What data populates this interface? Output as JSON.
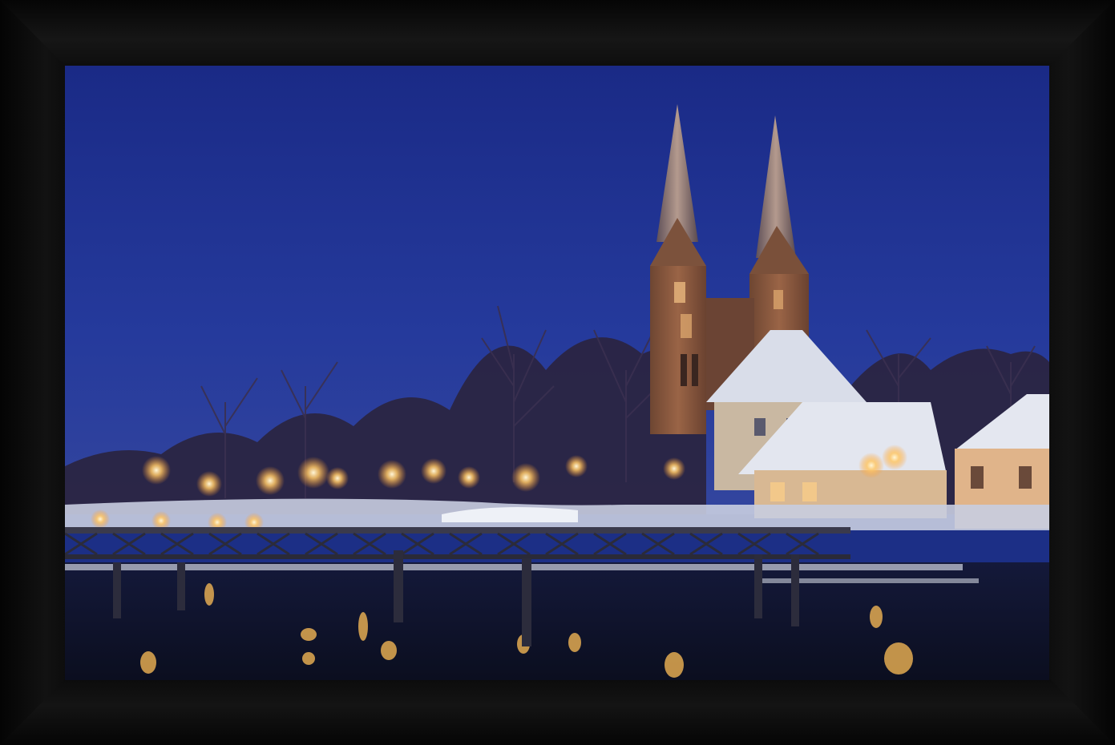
{
  "scene": {
    "subject": "framed-night-photo-church-with-twin-spires-over-frozen-lake",
    "palette": {
      "sky_top": "#1a2b8a",
      "sky_bottom": "#2c3f9e",
      "frame": "#0b0b0b",
      "brick": "#8a5a3e",
      "snow": "#dfe3ee",
      "lamp": "#ffd27a",
      "water": "#101428"
    }
  }
}
